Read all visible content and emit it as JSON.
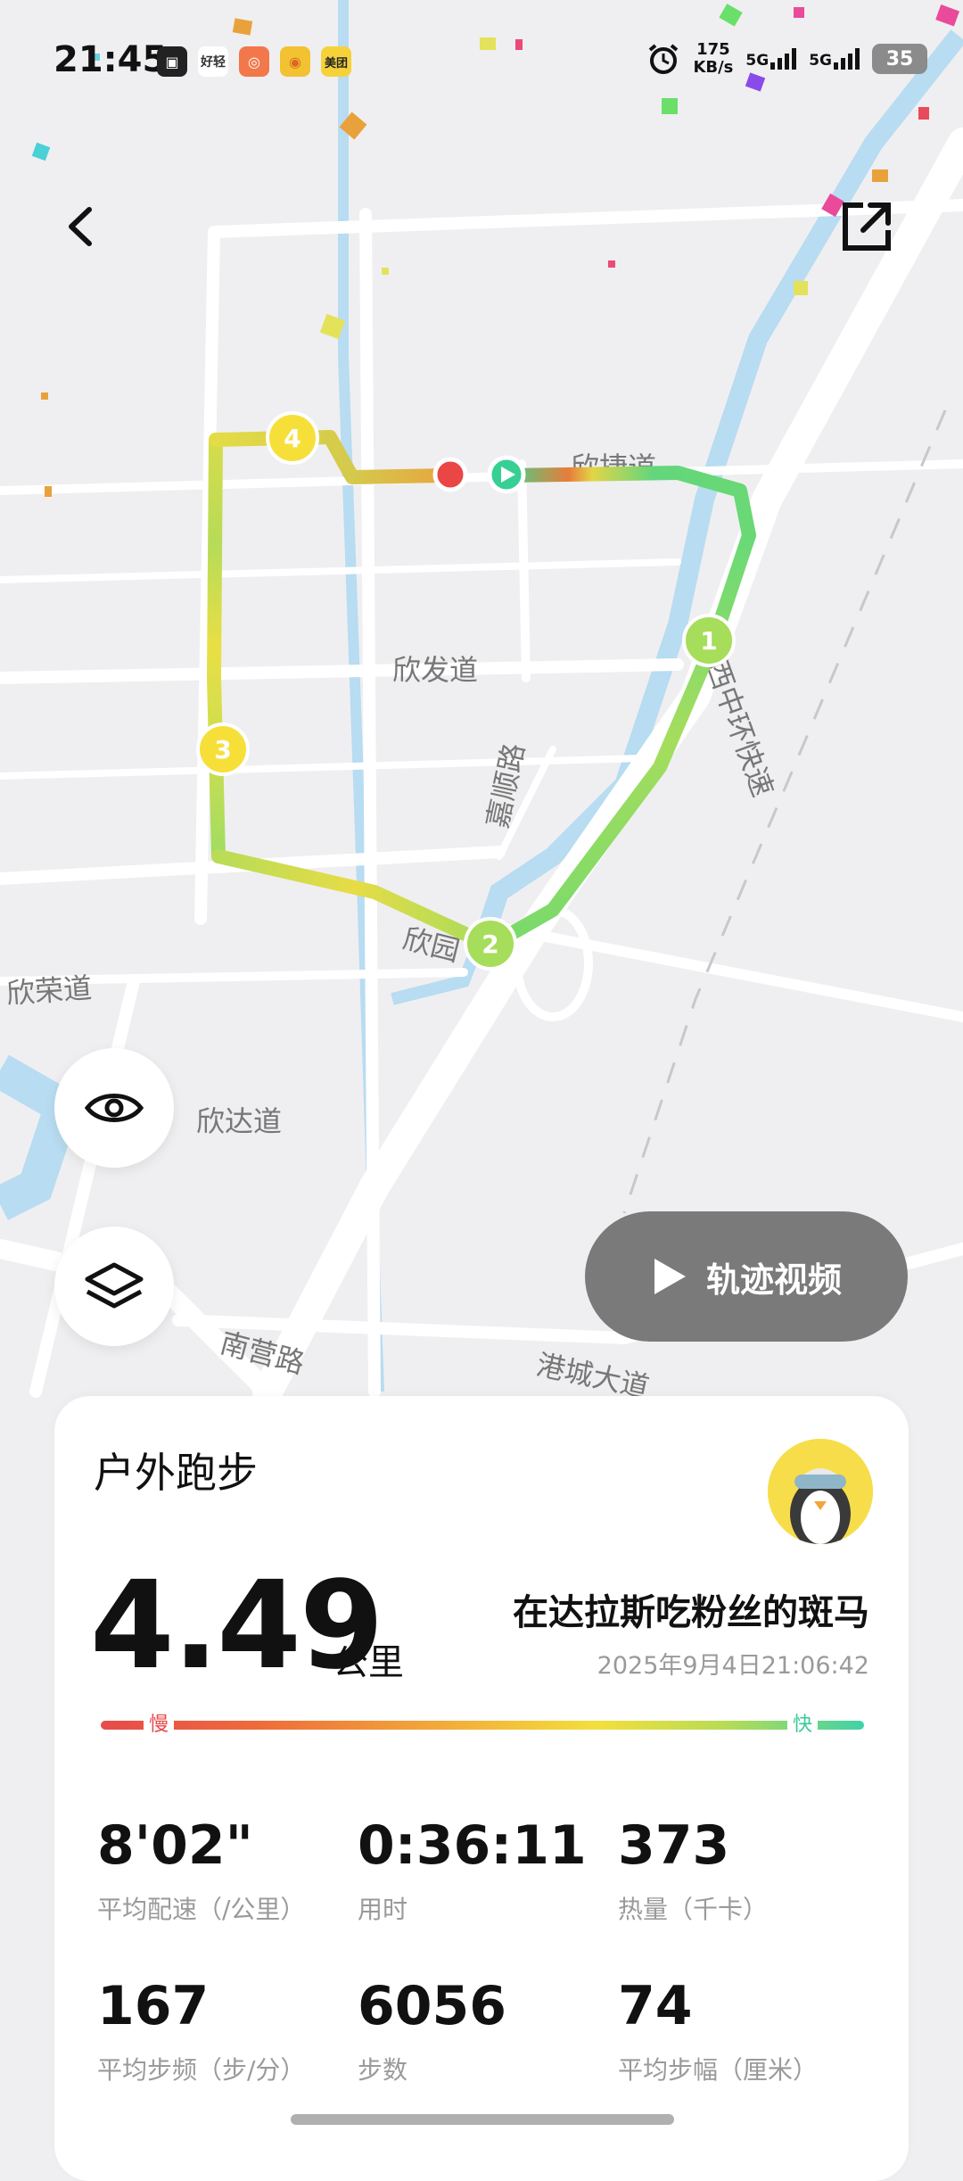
{
  "status_bar": {
    "time": "21:45",
    "apps": [
      "notes",
      "好轻",
      "target",
      "微博",
      "美团"
    ],
    "net_speed_value": "175",
    "net_speed_unit": "KB/s",
    "sim1": "5G",
    "sim2": "5G",
    "battery": "35"
  },
  "map": {
    "road_labels": {
      "xinjie": "欣捷道",
      "xinfa": "欣发道",
      "jiashun": "嘉顺路",
      "xizhong": "西中环快速",
      "xinrong": "欣荣道",
      "xinda": "欣达道",
      "xinyuan": "欣园",
      "nanying": "南营路",
      "gangcheng": "港城大道"
    },
    "km_markers": [
      "1",
      "2",
      "3",
      "4"
    ]
  },
  "actions": {
    "video_label": "轨迹视频"
  },
  "card": {
    "sport_type": "户外跑步",
    "distance": "4.49",
    "distance_unit": "公里",
    "user_name": "在达拉斯吃粉丝的斑马",
    "datetime": "2025年9月4日21:06:42",
    "pace_slow": "慢",
    "pace_fast": "快",
    "stats": [
      {
        "value": "8'02\"",
        "label": "平均配速（/公里）"
      },
      {
        "value": "0:36:11",
        "label": "用时"
      },
      {
        "value": "373",
        "label": "热量（千卡）"
      },
      {
        "value": "167",
        "label": "平均步频（步/分）"
      },
      {
        "value": "6056",
        "label": "步数"
      },
      {
        "value": "74",
        "label": "平均步幅（厘米）"
      }
    ]
  },
  "colors": {
    "route_slow": "#e64b4b",
    "route_mid": "#f3df3d",
    "route_fast": "#3fd2a8",
    "marker": "#a6dd5a",
    "marker_yellow": "#f7df3a",
    "water": "#b8dcf1"
  }
}
